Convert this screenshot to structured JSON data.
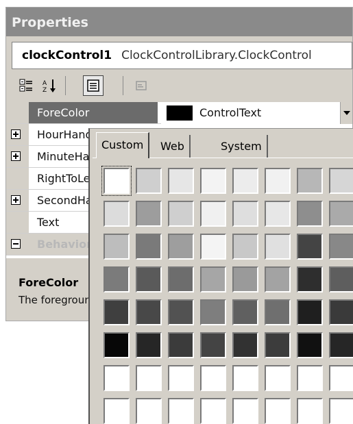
{
  "window": {
    "title": "Properties",
    "object_name": "clockControl1",
    "object_type": "ClockControlLibrary.ClockControl"
  },
  "toolbar": {
    "buttons": [
      {
        "name": "categorized-icon",
        "pressed": false
      },
      {
        "name": "alphabetical-icon",
        "pressed": false
      },
      {
        "name": "properties-icon",
        "pressed": true
      },
      {
        "name": "property-pages-icon",
        "pressed": false
      }
    ]
  },
  "grid": {
    "rows": [
      {
        "label": "ForeColor",
        "expander": "none",
        "selected": true,
        "category": false
      },
      {
        "label": "HourHand",
        "expander": "plus",
        "selected": false,
        "category": false
      },
      {
        "label": "MinuteHand",
        "expander": "plus",
        "selected": false,
        "category": false
      },
      {
        "label": "RightToLeft",
        "expander": "none",
        "selected": false,
        "category": false
      },
      {
        "label": "SecondHand",
        "expander": "plus",
        "selected": false,
        "category": false
      },
      {
        "label": "Text",
        "expander": "none",
        "selected": false,
        "category": false
      },
      {
        "label": "Behavior",
        "expander": "minus",
        "selected": false,
        "category": true
      }
    ],
    "selected_value": {
      "swatch_color": "#000000",
      "text": "ControlText"
    }
  },
  "description": {
    "title": "ForeColor",
    "text": "The foreground color of the component."
  },
  "color_picker": {
    "tabs": [
      {
        "label": "Custom",
        "active": true
      },
      {
        "label": "Web",
        "active": false
      },
      {
        "label": "System",
        "active": false
      }
    ],
    "selected_index": 0,
    "palette": [
      [
        "#ffffff",
        "#cfcfcf",
        "#e6e6e6",
        "#f3f3f3",
        "#ececec",
        "#f1f1f1",
        "#b7b7b7",
        "#d6d6d6"
      ],
      [
        "#dcdcdc",
        "#9d9d9d",
        "#cfcfcf",
        "#f0f0f0",
        "#dedede",
        "#e7e7e7",
        "#8e8e8e",
        "#aaaaaa"
      ],
      [
        "#bdbdbd",
        "#7a7a7a",
        "#9e9e9e",
        "#f4f4f4",
        "#c8c8c8",
        "#e0e0e0",
        "#444444",
        "#888888"
      ],
      [
        "#7b7b7b",
        "#5a5a5a",
        "#6d6d6d",
        "#a6a6a6",
        "#9a9a9a",
        "#a3a3a3",
        "#2e2e2e",
        "#5e5e5e"
      ],
      [
        "#3f3f3f",
        "#484848",
        "#525252",
        "#7e7e7e",
        "#606060",
        "#6f6f6f",
        "#1f1f1f",
        "#3a3a3a"
      ],
      [
        "#070707",
        "#262626",
        "#3b3b3b",
        "#444444",
        "#323232",
        "#3c3c3c",
        "#111111",
        "#262626"
      ],
      [
        "#ffffff",
        "#ffffff",
        "#ffffff",
        "#ffffff",
        "#ffffff",
        "#ffffff",
        "#ffffff",
        "#ffffff"
      ],
      [
        "#ffffff",
        "#ffffff",
        "#ffffff",
        "#ffffff",
        "#ffffff",
        "#ffffff",
        "#ffffff",
        "#ffffff"
      ]
    ]
  }
}
